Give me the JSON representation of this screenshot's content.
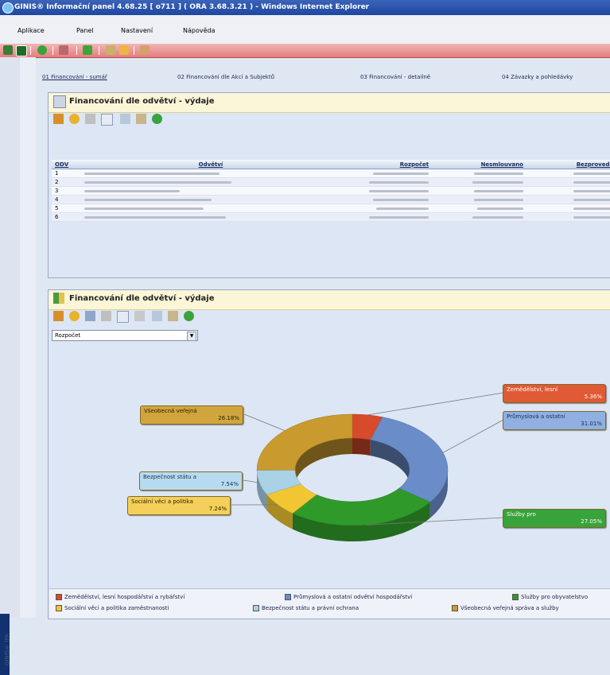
{
  "window": {
    "title": "GINIS® Informační panel 4.68.25 [ o711 ] ( ORA 3.68.3.21 ) - Windows Internet Explorer"
  },
  "menu": [
    "Aplikace",
    "Panel",
    "Nastavení",
    "Nápověda"
  ],
  "toolbar": {
    "icons": [
      "user-icon",
      "app-icon",
      "refresh-icon",
      "home-icon",
      "add-icon",
      "list-icon",
      "tools-icon",
      "report-icon"
    ]
  },
  "sidebar": {
    "label": "GINIS® IPA"
  },
  "tabs": [
    {
      "label": "01 Financování - sumář",
      "active": true
    },
    {
      "label": "02 Financování dle Akcí a Subjektů",
      "active": false
    },
    {
      "label": "03 Financování - detailně",
      "active": false
    },
    {
      "label": "04 Závazky a pohledávky",
      "active": false
    }
  ],
  "table_panel": {
    "title": "Financování dle odvětví - výdaje",
    "columns": [
      "ODV",
      "Odvětví",
      "Rozpočet",
      "Nesmlouvano",
      "Bezprovedeno"
    ],
    "rows": [
      {
        "odv": "1"
      },
      {
        "odv": "2"
      },
      {
        "odv": "3"
      },
      {
        "odv": "4"
      },
      {
        "odv": "5"
      },
      {
        "odv": "6"
      }
    ]
  },
  "chart_panel": {
    "title": "Financování dle odvětví - výdaje",
    "select_value": "Rozpočet"
  },
  "chart_data": {
    "type": "pie",
    "style": "donut-3d",
    "series": [
      {
        "name": "Zemědělství, lesní",
        "value": 5.36,
        "label": "5.36%",
        "color": "#d84a2c"
      },
      {
        "name": "Průmyslová a ostatní",
        "value": 31.01,
        "label": "31.01%",
        "color": "#6a8cc8"
      },
      {
        "name": "Služby pro",
        "value": 27.05,
        "label": "27.05%",
        "color": "#2f9a2a"
      },
      {
        "name": "Sociální věci a politika",
        "value": 7.24,
        "label": "7.24%",
        "color": "#f2c633"
      },
      {
        "name": "Bezpečnost státu a",
        "value": 7.54,
        "label": "7.54%",
        "color": "#a9d2e6"
      },
      {
        "name": "Všeobecná veřejná",
        "value": 26.18,
        "label": "26.18%",
        "color": "#c99a2e"
      }
    ],
    "legend": [
      {
        "label": "Zemědělství, lesní hospodářství a rybářství",
        "color": "#d84a2c"
      },
      {
        "label": "Průmyslová a ostatní odvětví hospodářství",
        "color": "#6a8cc8"
      },
      {
        "label": "Služby pro obyvatelstvo",
        "color": "#2f9a2a"
      },
      {
        "label": "Sociální věci a politika zaměstnanosti",
        "color": "#f2c633"
      },
      {
        "label": "Bezpečnost státu a právní ochrana",
        "color": "#a9d2e6"
      },
      {
        "label": "Všeobecná veřejná správa a služby",
        "color": "#c99a2e"
      }
    ]
  }
}
